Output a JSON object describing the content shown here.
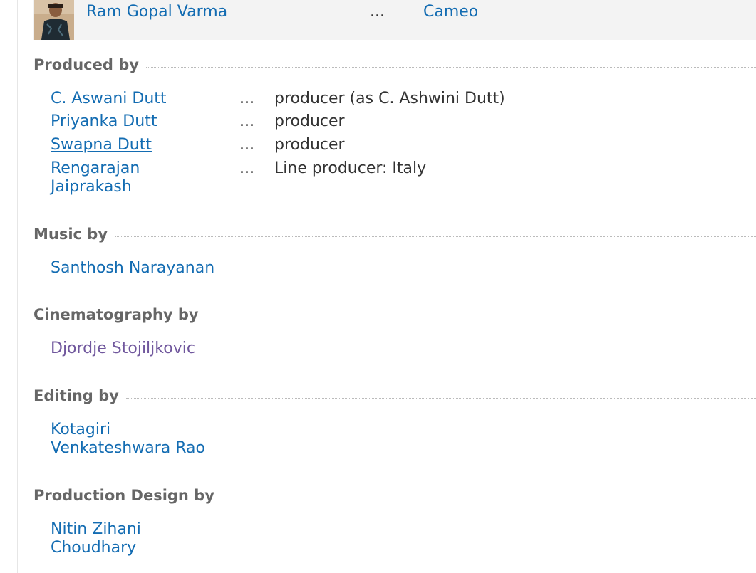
{
  "cast": {
    "name": "Ram Gopal Varma",
    "dots": "...",
    "role": "Cameo"
  },
  "sections": {
    "produced_by": {
      "title": "Produced by",
      "rows": [
        {
          "name": "C. Aswani Dutt",
          "dots": "...",
          "credit": "producer (as C. Ashwini Dutt)"
        },
        {
          "name": "Priyanka Dutt",
          "dots": "...",
          "credit": "producer"
        },
        {
          "name": "Swapna Dutt",
          "dots": "...",
          "credit": "producer"
        },
        {
          "name_line1": "Rengarajan",
          "name_line2": "Jaiprakash",
          "dots": "...",
          "credit": "Line producer: Italy"
        }
      ]
    },
    "music_by": {
      "title": "Music by",
      "rows": [
        {
          "name": "Santhosh Narayanan"
        }
      ]
    },
    "cinematography_by": {
      "title": "Cinematography by",
      "rows": [
        {
          "name": "Djordje Stojiljkovic"
        }
      ]
    },
    "editing_by": {
      "title": "Editing by",
      "rows": [
        {
          "name_line1": "Kotagiri",
          "name_line2": "Venkateshwara Rao"
        }
      ]
    },
    "production_design_by": {
      "title": "Production Design by",
      "rows": [
        {
          "name_line1": "Nitin Zihani",
          "name_line2": "Choudhary"
        }
      ]
    }
  },
  "colors": {
    "link": "#136cb2",
    "visited_link": "#70579d",
    "heading": "#666666"
  }
}
